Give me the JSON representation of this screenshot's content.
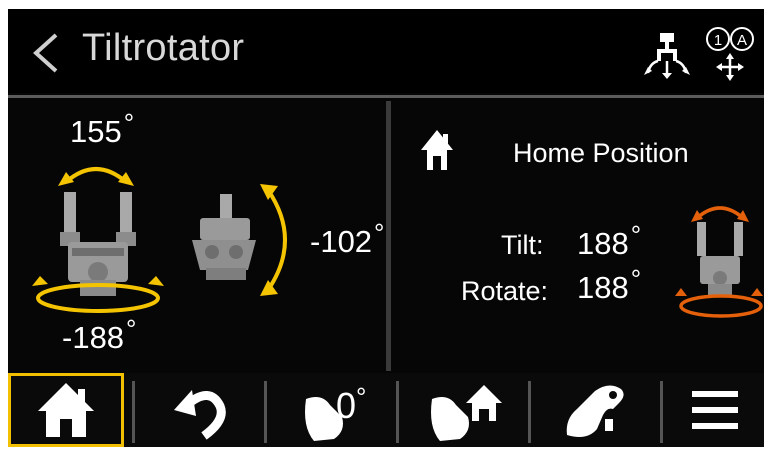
{
  "header": {
    "title": "Tiltrotator",
    "back_icon": "chevron-left-icon",
    "icons": [
      "boom-control-icon",
      "mode-selector-1a-icon"
    ],
    "mode_icon_text_1": "1",
    "mode_icon_text_2": "A"
  },
  "tilt_panel": {
    "rotate_cw_value": "155",
    "rotate_ccw_value": "-188",
    "tilt_value": "-102",
    "degree_symbol": "°",
    "arrow_color": "#f5c400"
  },
  "home_panel": {
    "title": "Home Position",
    "tilt_label": "Tilt:",
    "tilt_value": "188",
    "rotate_label": "Rotate:",
    "rotate_value": "188",
    "degree_symbol": "°",
    "arrow_color": "#e5600a"
  },
  "toolbar": {
    "active_color": "#f2c000",
    "zero_label": "0",
    "degree_symbol": "°",
    "buttons": [
      "home-button",
      "undo-button",
      "zero-position-button",
      "home-position-button",
      "bucket-button",
      "menu-button"
    ]
  }
}
